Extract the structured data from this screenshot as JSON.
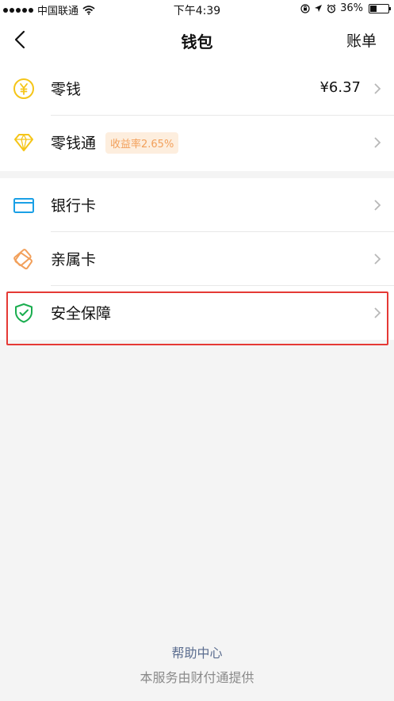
{
  "status_bar": {
    "carrier": "中国联通",
    "time": "下午4:39",
    "battery": "36%",
    "battery_level": 0.36
  },
  "nav": {
    "title": "钱包",
    "right_label": "账单"
  },
  "wallet_items": [
    {
      "label": "零钱",
      "value": "¥6.37",
      "icon": "yuan-coin-icon"
    },
    {
      "label": "零钱通",
      "badge": "收益率2.65%",
      "icon": "diamond-icon"
    }
  ],
  "card_items": [
    {
      "label": "银行卡",
      "icon": "bank-card-icon"
    },
    {
      "label": "亲属卡",
      "icon": "family-card-icon"
    },
    {
      "label": "安全保障",
      "icon": "shield-icon"
    }
  ],
  "footer": {
    "help_link": "帮助中心",
    "note": "本服务由财付通提供"
  },
  "colors": {
    "highlight_border": "#e53935",
    "coin": "#f5c518",
    "card_blue": "#1aa0e6",
    "family_orange": "#f2a05b",
    "shield_green": "#1aad4f"
  }
}
